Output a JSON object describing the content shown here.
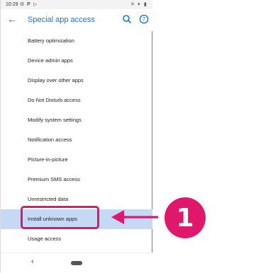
{
  "status": {
    "time": "10:29",
    "left_icons": [
      "settings-icon",
      "p-icon",
      "play-icon"
    ],
    "right_icons": [
      "mute-icon",
      "wifi-icon",
      "battery-icon"
    ]
  },
  "appbar": {
    "title": "Special app access"
  },
  "items": [
    {
      "label": "Battery optimization"
    },
    {
      "label": "Device admin apps"
    },
    {
      "label": "Display over other apps"
    },
    {
      "label": "Do Not Disturb access"
    },
    {
      "label": "Modify system settings"
    },
    {
      "label": "Notification access"
    },
    {
      "label": "Picture-in-picture"
    },
    {
      "label": "Premium SMS access"
    },
    {
      "label": "Unrestricted data"
    },
    {
      "label": "Install unknown apps"
    },
    {
      "label": "Usage access"
    }
  ],
  "annotation": {
    "step_number": "1",
    "accent_color": "#e0186b",
    "highlight_color": "#c5d9f5"
  }
}
